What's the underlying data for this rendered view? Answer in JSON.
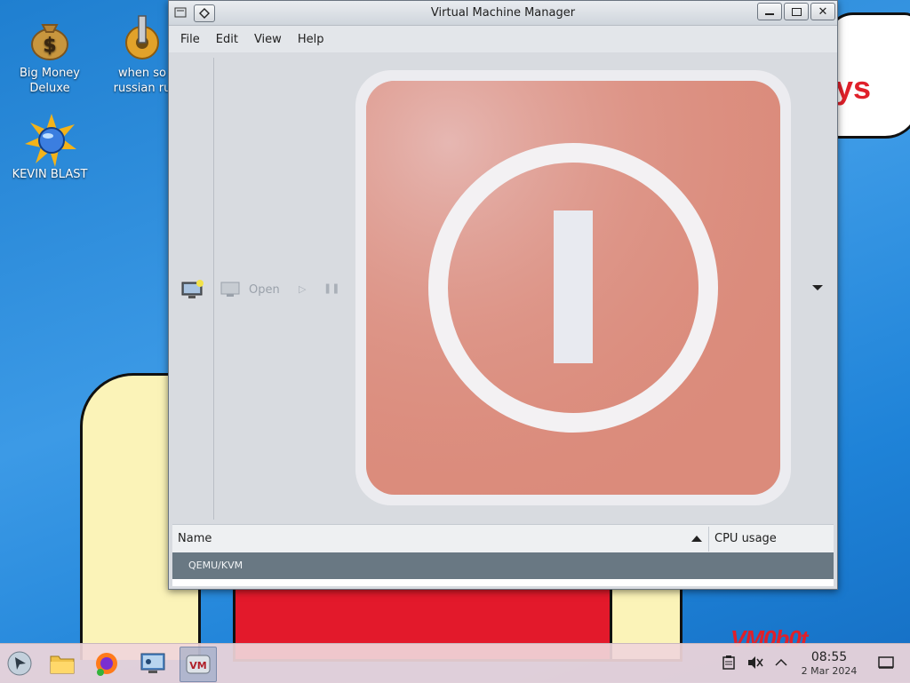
{
  "desktop": {
    "icons": [
      {
        "label": "Big Money\nDeluxe",
        "icon": "money-bag-icon"
      },
      {
        "label": "when so\nrussian ru",
        "icon": "gear-tower-icon"
      },
      {
        "label": "KEVIN BLAST",
        "icon": "globe-burst-icon"
      }
    ],
    "wallpaper_text": "ys",
    "logo_text": "VM0b0t"
  },
  "window": {
    "title": "Virtual Machine Manager",
    "menu": [
      "File",
      "Edit",
      "View",
      "Help"
    ],
    "toolbar": {
      "open_label": "Open"
    },
    "list": {
      "col_name": "Name",
      "col_cpu": "CPU usage",
      "rows": [
        {
          "name": "QEMU/KVM"
        }
      ]
    }
  },
  "taskbar": {
    "apps": [
      {
        "name": "start-menu",
        "icon": "start-icon"
      },
      {
        "name": "file-manager",
        "icon": "folder-icon"
      },
      {
        "name": "firefox",
        "icon": "firefox-icon"
      },
      {
        "name": "system-settings",
        "icon": "settings-icon"
      },
      {
        "name": "virt-manager",
        "icon": "vm-icon",
        "active": true
      }
    ],
    "clock_time": "08:55",
    "clock_date": "2 Mar 2024"
  }
}
